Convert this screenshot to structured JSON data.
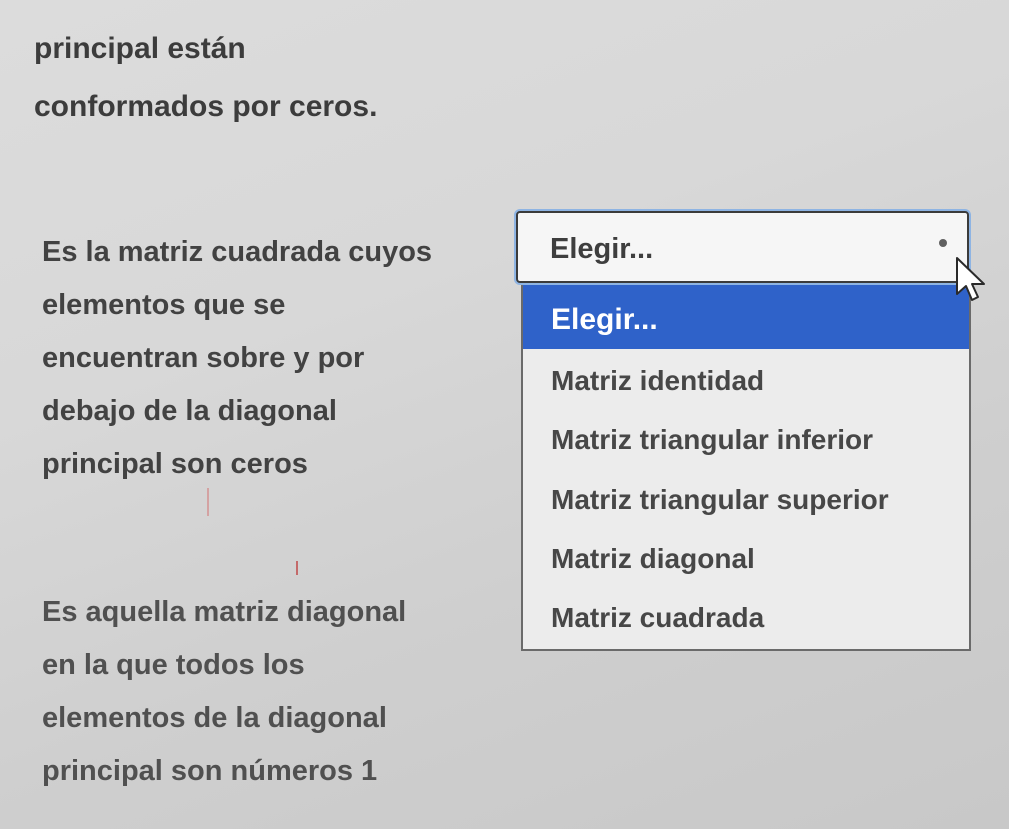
{
  "previous_question": {
    "lines": [
      "principal están",
      "conformados por ceros."
    ]
  },
  "questions": [
    {
      "lines": [
        "Es la matriz cuadrada cuyos",
        "elementos que se",
        "encuentran sobre y por",
        "debajo de la diagonal",
        "principal son ceros"
      ]
    },
    {
      "lines": [
        "Es aquella matriz diagonal",
        "en la que todos los",
        "elementos de la diagonal",
        "principal son números 1"
      ]
    }
  ],
  "select": {
    "current_value": "Elegir...",
    "options": [
      "Elegir...",
      "Matriz identidad",
      "Matriz triangular inferior",
      "Matriz triangular superior",
      "Matriz diagonal",
      "Matriz cuadrada"
    ],
    "highlighted_index": 0
  },
  "colors": {
    "highlight": "#2f62c9",
    "focus_ring": "#8eb4e3"
  }
}
